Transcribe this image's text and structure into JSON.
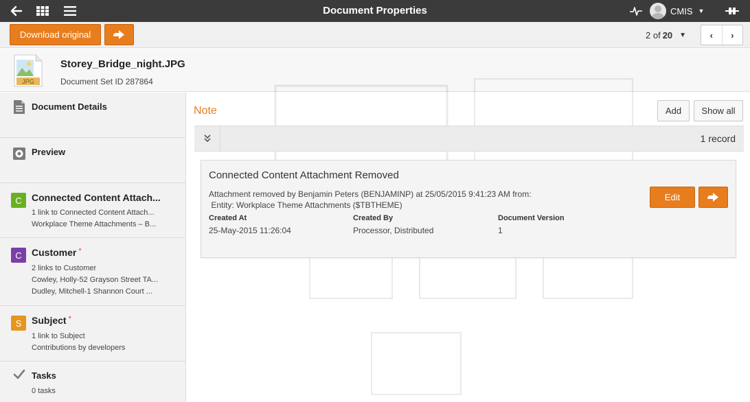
{
  "topbar": {
    "title": "Document Properties",
    "user_name": "CMIS",
    "icons": [
      "back-arrow-icon",
      "apps-grid-icon",
      "hamburger-menu-icon",
      "activity-pulse-icon",
      "user-avatar-icon",
      "chevron-down-icon",
      "server-plug-icon"
    ]
  },
  "toolbar": {
    "download_label": "Download original",
    "pager_current": "2 of",
    "pager_total": "20"
  },
  "document": {
    "filename": "Storey_Bridge_night.JPG",
    "set_id_label": "Document Set ID 287864",
    "file_type": "JPG"
  },
  "sidebar": {
    "items": [
      {
        "key": "document-details",
        "label": "Document Details",
        "icon": "document-lines-icon"
      },
      {
        "key": "preview",
        "label": "Preview",
        "icon": "eye-icon"
      },
      {
        "key": "connected-content",
        "label": "Connected Content Attach...",
        "badge": "C",
        "badge_color": "#6ab023",
        "lines": [
          "1 link to Connected Content Attach...",
          "Workplace Theme Attachments – B..."
        ]
      },
      {
        "key": "customer",
        "label": "Customer",
        "required": "*",
        "badge": "C",
        "badge_color": "#7b3fa8",
        "lines": [
          "2 links to Customer",
          "Cowley, Holly-52 Grayson Street TA...",
          "Dudley, Mitchell-1 Shannon Court ..."
        ]
      },
      {
        "key": "subject",
        "label": "Subject",
        "required": "*",
        "badge": "S",
        "badge_color": "#e6951e",
        "lines": [
          "1 link to Subject",
          "Contributions by developers"
        ]
      },
      {
        "key": "tasks",
        "label": "Tasks",
        "icon": "checkmark-icon",
        "lines": [
          "0 tasks"
        ]
      }
    ]
  },
  "main": {
    "section_title": "Note",
    "add_label": "Add",
    "show_all_label": "Show all",
    "record_count": "1 record",
    "note": {
      "title": "Connected Content Attachment Removed",
      "description": "Attachment removed by Benjamin Peters (BENJAMINP) at 25/05/2015 9:41:23 AM from:\n Entity: Workplace Theme Attachments ($TBTHEME)",
      "fields": [
        {
          "label": "Created At",
          "value": "25-May-2015 11:26:04"
        },
        {
          "label": "Created By",
          "value": "Processor, Distributed"
        },
        {
          "label": "Document Version",
          "value": "1"
        }
      ],
      "edit_label": "Edit"
    }
  },
  "colors": {
    "accent_orange": "#e87d1e",
    "topbar_bg": "#3b3b3b"
  }
}
